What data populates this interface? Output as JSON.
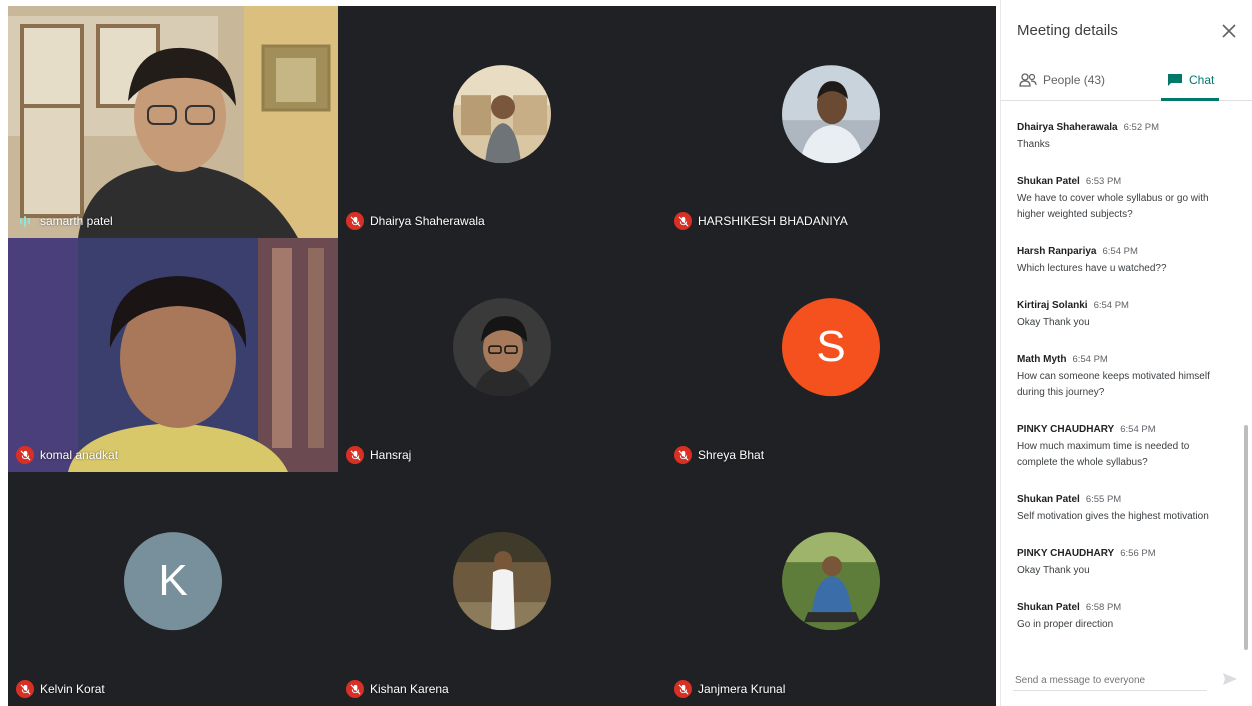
{
  "tiles": [
    {
      "name": "samarth patel",
      "muted": false
    },
    {
      "name": "Dhairya Shaherawala",
      "muted": true
    },
    {
      "name": "HARSHIKESH BHADANIYA",
      "muted": true
    },
    {
      "name": "komal anadkat",
      "muted": true
    },
    {
      "name": "Hansraj",
      "muted": true
    },
    {
      "name": "Shreya Bhat",
      "muted": true,
      "initial": "S",
      "avatar_color": "#f4511e"
    },
    {
      "name": "Kelvin Korat",
      "muted": true,
      "initial": "K",
      "avatar_color": "#78909c"
    },
    {
      "name": "Kishan Karena",
      "muted": true
    },
    {
      "name": "Janjmera Krunal",
      "muted": true
    }
  ],
  "panel": {
    "title": "Meeting details",
    "people_tab": "People (43)",
    "chat_tab": "Chat",
    "messages": [
      {
        "sender": "Dhairya Shaherawala",
        "time": "6:52 PM",
        "lines": [
          "Thanks"
        ]
      },
      {
        "sender": "Shukan Patel",
        "time": "6:53 PM",
        "lines": [
          "We have to cover whole syllabus or go with",
          "higher weighted subjects?"
        ]
      },
      {
        "sender": "Harsh Ranpariya",
        "time": "6:54 PM",
        "lines": [
          "Which lectures have u watched??"
        ]
      },
      {
        "sender": "Kirtiraj Solanki",
        "time": "6:54 PM",
        "lines": [
          "Okay Thank you"
        ]
      },
      {
        "sender": "Math Myth",
        "time": "6:54 PM",
        "lines": [
          "How can someone keeps motivated himself",
          "during this journey?"
        ]
      },
      {
        "sender": "PINKY CHAUDHARY",
        "time": "6:54 PM",
        "lines": [
          "How much maximum time is needed to",
          "complete the whole syllabus?"
        ]
      },
      {
        "sender": "Shukan Patel",
        "time": "6:55 PM",
        "lines": [
          "Self motivation gives  the highest motivation"
        ]
      },
      {
        "sender": "PINKY CHAUDHARY",
        "time": "6:56 PM",
        "lines": [
          "Okay Thank you"
        ]
      },
      {
        "sender": "Shukan Patel",
        "time": "6:58 PM",
        "lines": [
          "Go in proper direction"
        ]
      }
    ],
    "compose_placeholder": "Send a message to everyone"
  },
  "colors": {
    "accent": "#00796b",
    "tile_bg": "#202124",
    "mute": "#d93025"
  }
}
